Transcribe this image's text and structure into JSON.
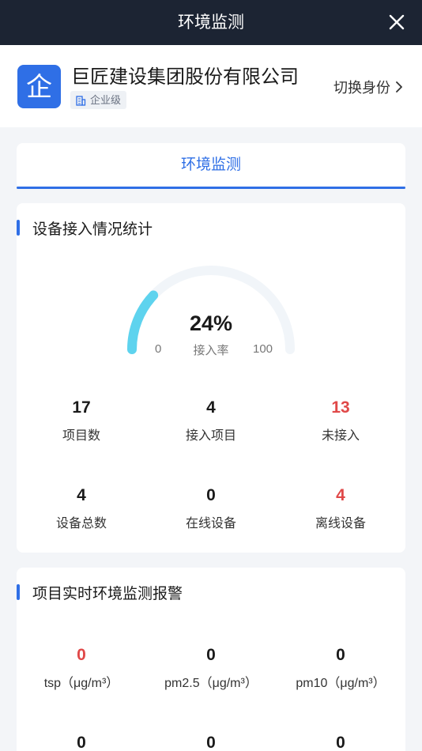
{
  "header": {
    "title": "环境监测"
  },
  "company": {
    "logo_char": "企",
    "name": "巨匠建设集团股份有限公司",
    "badge": "企业级",
    "switch_label": "切换身份"
  },
  "tabs": [
    {
      "label": "环境监测",
      "active": true
    }
  ],
  "access_stats": {
    "title": "设备接入情况统计",
    "gauge": {
      "value_label": "24%",
      "caption": "接入率",
      "min": "0",
      "max": "100",
      "progress": 0.24
    },
    "metrics": [
      {
        "value": "17",
        "label": "项目数",
        "highlight": false
      },
      {
        "value": "4",
        "label": "接入项目",
        "highlight": false
      },
      {
        "value": "13",
        "label": "未接入",
        "highlight": true
      },
      {
        "value": "4",
        "label": "设备总数",
        "highlight": false
      },
      {
        "value": "0",
        "label": "在线设备",
        "highlight": false
      },
      {
        "value": "4",
        "label": "离线设备",
        "highlight": true
      }
    ]
  },
  "alerts": {
    "title": "项目实时环境监测报警",
    "metrics": [
      {
        "value": "0",
        "label": "tsp（μg/m³）",
        "highlight": true
      },
      {
        "value": "0",
        "label": "pm2.5（μg/m³）",
        "highlight": false
      },
      {
        "value": "0",
        "label": "pm10（μg/m³）",
        "highlight": false
      },
      {
        "value": "0",
        "label": "",
        "highlight": false
      },
      {
        "value": "0",
        "label": "",
        "highlight": false
      },
      {
        "value": "0",
        "label": "",
        "highlight": false
      }
    ]
  },
  "colors": {
    "accent": "#2f6fe6",
    "header_bg": "#1c2433",
    "alert_red": "#e04848",
    "gauge_fill": "#5ed3ee",
    "gauge_track": "#f1f5f9"
  }
}
